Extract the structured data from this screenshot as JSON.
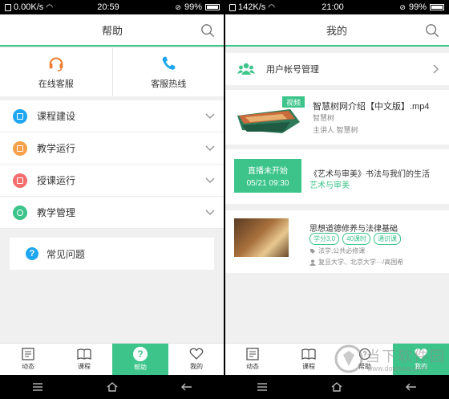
{
  "left": {
    "status": {
      "speed": "0.00K/s",
      "time": "20:59",
      "battery": "99%"
    },
    "title": "帮助",
    "services": [
      {
        "label": "在线客服",
        "icon": "headset-icon"
      },
      {
        "label": "客服热线",
        "icon": "phone-icon"
      }
    ],
    "accordion": [
      {
        "label": "课程建设",
        "color": "#1ea7f0"
      },
      {
        "label": "教学运行",
        "color": "#f5a14a"
      },
      {
        "label": "授课运行",
        "color": "#f26e6e"
      },
      {
        "label": "教学管理",
        "color": "#3cc48a"
      }
    ],
    "faq": {
      "icon_text": "?",
      "label": "常见问题"
    },
    "tabs": [
      {
        "label": "动态",
        "icon": "news-icon"
      },
      {
        "label": "课程",
        "icon": "book-icon"
      },
      {
        "label": "帮助",
        "icon": "help-icon",
        "active": true
      },
      {
        "label": "我的",
        "icon": "heart-icon"
      }
    ]
  },
  "right": {
    "status": {
      "speed": "142K/s",
      "time": "21:00",
      "battery": "99%"
    },
    "title": "我的",
    "account": {
      "label": "用户帐号管理"
    },
    "video": {
      "badge": "视频",
      "title": "智慧树网介绍【中文版】.mp4",
      "org": "智慧树",
      "lecturer": "主讲人 智慧树"
    },
    "live": {
      "status": "直播未开始",
      "time": "05/21 09:30",
      "title": "《艺术与审美》书法与我们的生活",
      "course": "艺术与审美"
    },
    "course": {
      "title": "思想道德修养与法律基础",
      "tags": [
        "学分3.0",
        "40课时",
        "通识课"
      ],
      "category": "法学,公共必修课",
      "schools": "复旦大学、北京大学···/高国希"
    },
    "tabs": [
      {
        "label": "动态"
      },
      {
        "label": "课程"
      },
      {
        "label": "帮助"
      },
      {
        "label": "我的",
        "active": true
      }
    ],
    "watermark": {
      "text": "当下软件园",
      "url": "www.downxia.com"
    }
  },
  "colors": {
    "accent": "#3cc48a",
    "blue": "#1ea7f0"
  }
}
